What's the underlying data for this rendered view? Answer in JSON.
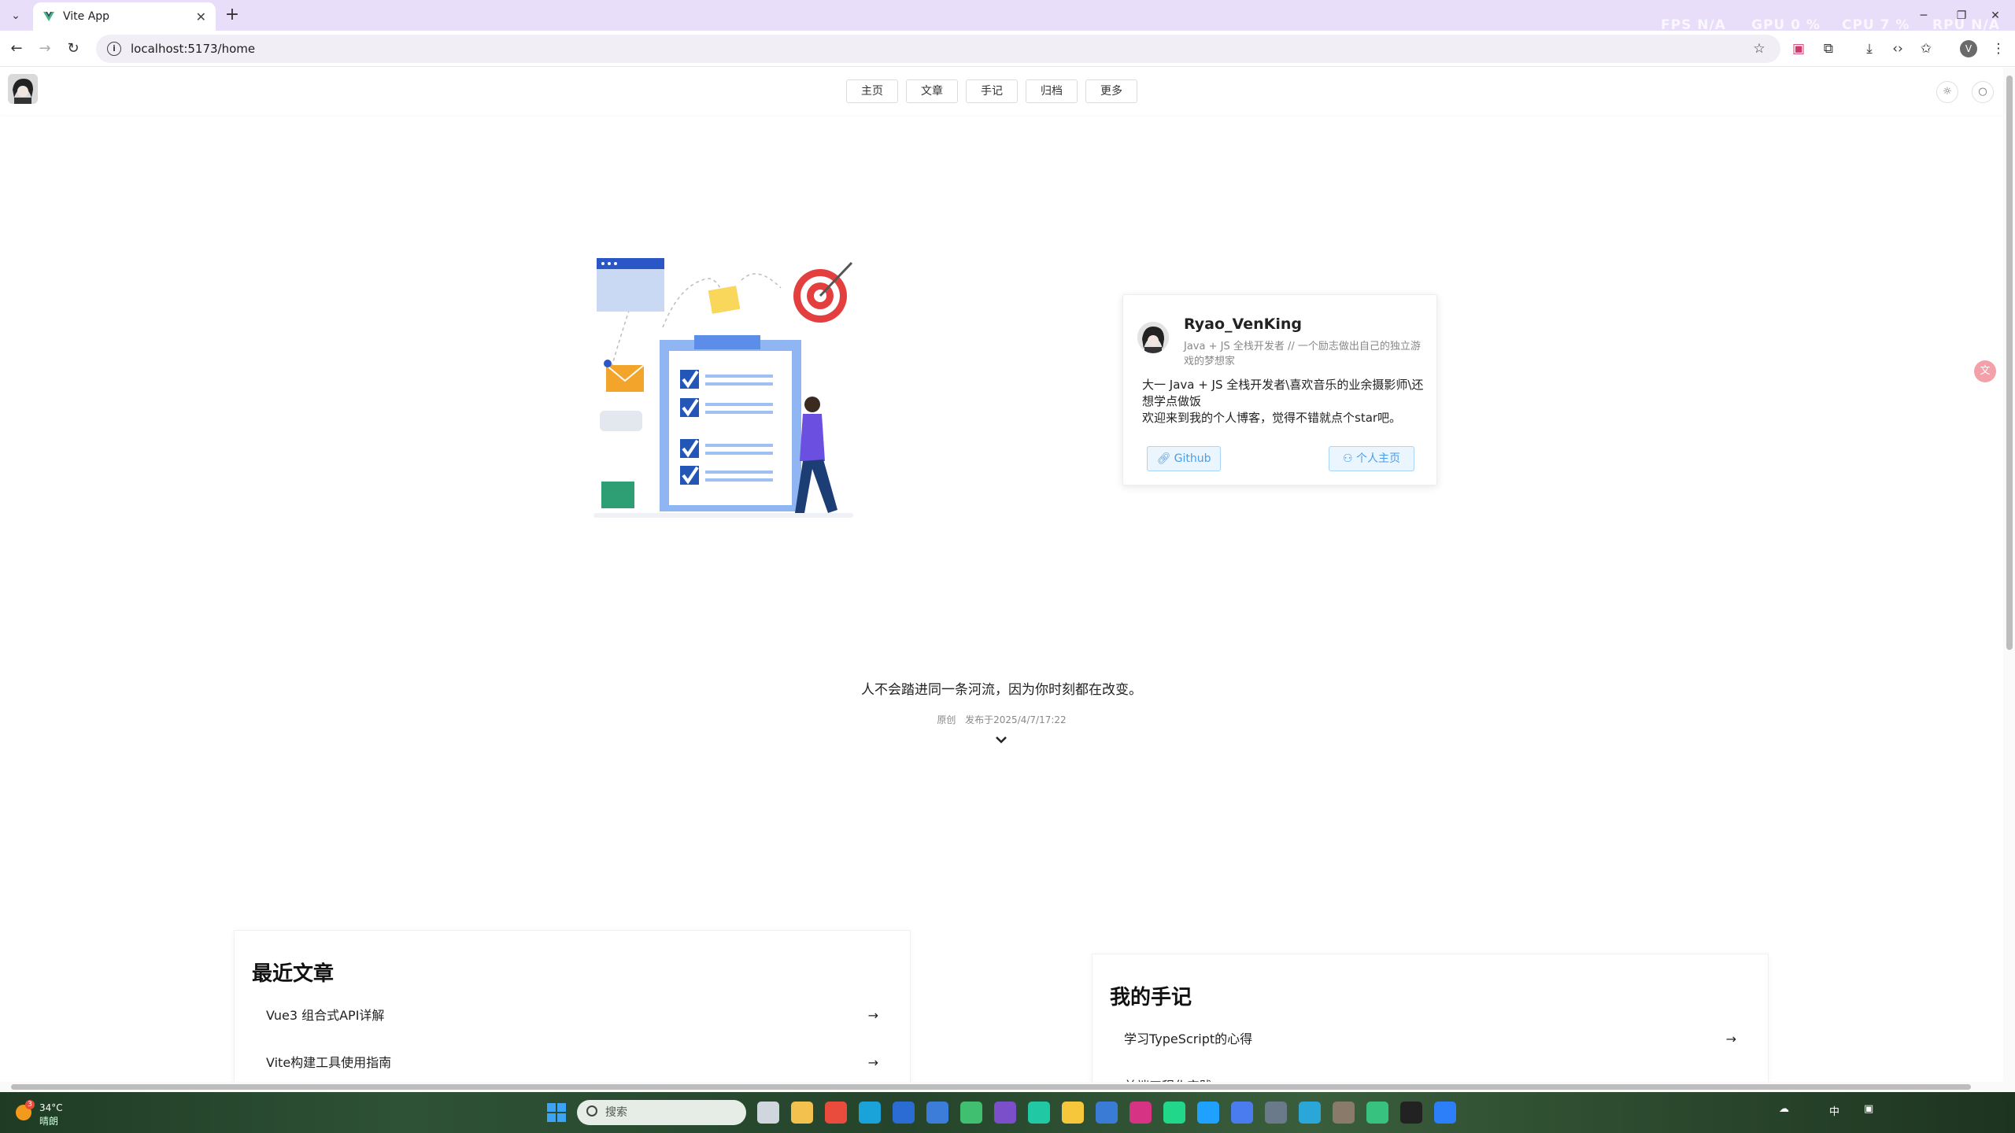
{
  "browser": {
    "tab_title": "Vite App",
    "tab_close": "✕",
    "new_tab": "+",
    "url": "localhost:5173/home",
    "profile_initial": "V",
    "hud": [
      "FPS N/A",
      "GPU 0 %",
      "CPU 7 %",
      "RPU N/A"
    ]
  },
  "site": {
    "nav": [
      "主页",
      "文章",
      "手记",
      "归档",
      "更多"
    ],
    "theme_icon": "sun-icon",
    "search_icon": "search-icon"
  },
  "profile_card": {
    "name": "Ryao_VenKing",
    "tagline": "Java + JS 全栈开发者 // 一个励志做出自己的独立游戏的梦想家",
    "bio": "大一 Java + JS 全栈开发者\\喜欢音乐的业余摄影师\\还想学点做饭\n欢迎来到我的个人博客，觉得不错就点个star吧。",
    "github_label": "Github",
    "homepage_label": "个人主页"
  },
  "hero": {
    "quote": "人不会踏进同一条河流，因为你时刻都在改变。",
    "tag": "原创",
    "published": "发布于2025/4/7/17:22"
  },
  "recent_articles": {
    "title": "最近文章",
    "items": [
      "Vue3 组合式API详解",
      "Vite构建工具使用指南"
    ]
  },
  "my_notes": {
    "title": "我的手记",
    "items": [
      "学习TypeScript的心得",
      "前端工程化实践"
    ]
  },
  "translate_fab": "文",
  "taskbar": {
    "weather_temp": "34°C",
    "weather_desc": "晴朗",
    "weather_badge": "3",
    "search_placeholder": "搜索",
    "ime": "中"
  }
}
